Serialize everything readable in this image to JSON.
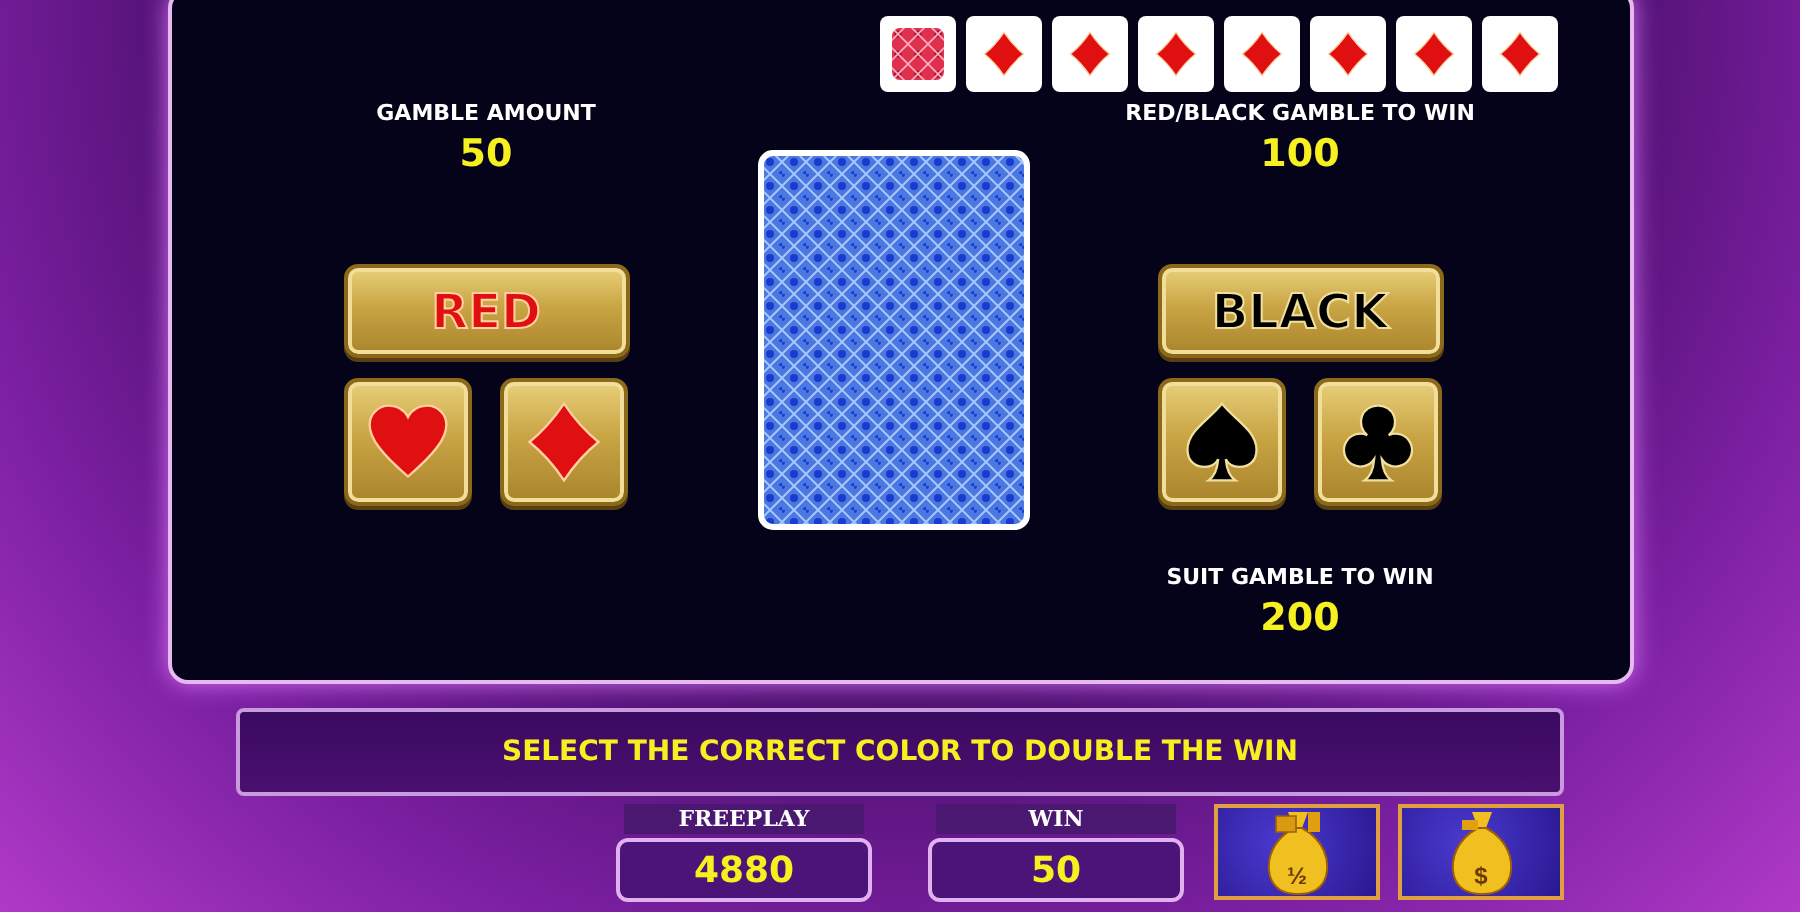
{
  "history": [
    {
      "kind": "back"
    },
    {
      "kind": "diamond"
    },
    {
      "kind": "diamond"
    },
    {
      "kind": "diamond"
    },
    {
      "kind": "diamond"
    },
    {
      "kind": "diamond"
    },
    {
      "kind": "diamond"
    },
    {
      "kind": "diamond"
    }
  ],
  "gamble_amount": {
    "label": "GAMBLE AMOUNT",
    "value": "50"
  },
  "red_black": {
    "label": "RED/BLACK GAMBLE TO WIN",
    "value": "100"
  },
  "suit_gamble": {
    "label": "SUIT GAMBLE TO WIN",
    "value": "200"
  },
  "color_buttons": [
    {
      "kind": "red",
      "label": "RED"
    },
    {
      "kind": "black",
      "label": "BLACK"
    }
  ],
  "suit_buttons": [
    {
      "kind": "heart"
    },
    {
      "kind": "diamond"
    },
    {
      "kind": "spade"
    },
    {
      "kind": "club"
    }
  ],
  "message": "SELECT THE CORRECT COLOR TO DOUBLE THE WIN",
  "meters": [
    {
      "label": "FREEPLAY",
      "value": "4880"
    },
    {
      "label": "WIN",
      "value": "50"
    }
  ],
  "actions": [
    {
      "kind": "half",
      "label": "½"
    },
    {
      "kind": "dollar",
      "label": "$"
    }
  ]
}
